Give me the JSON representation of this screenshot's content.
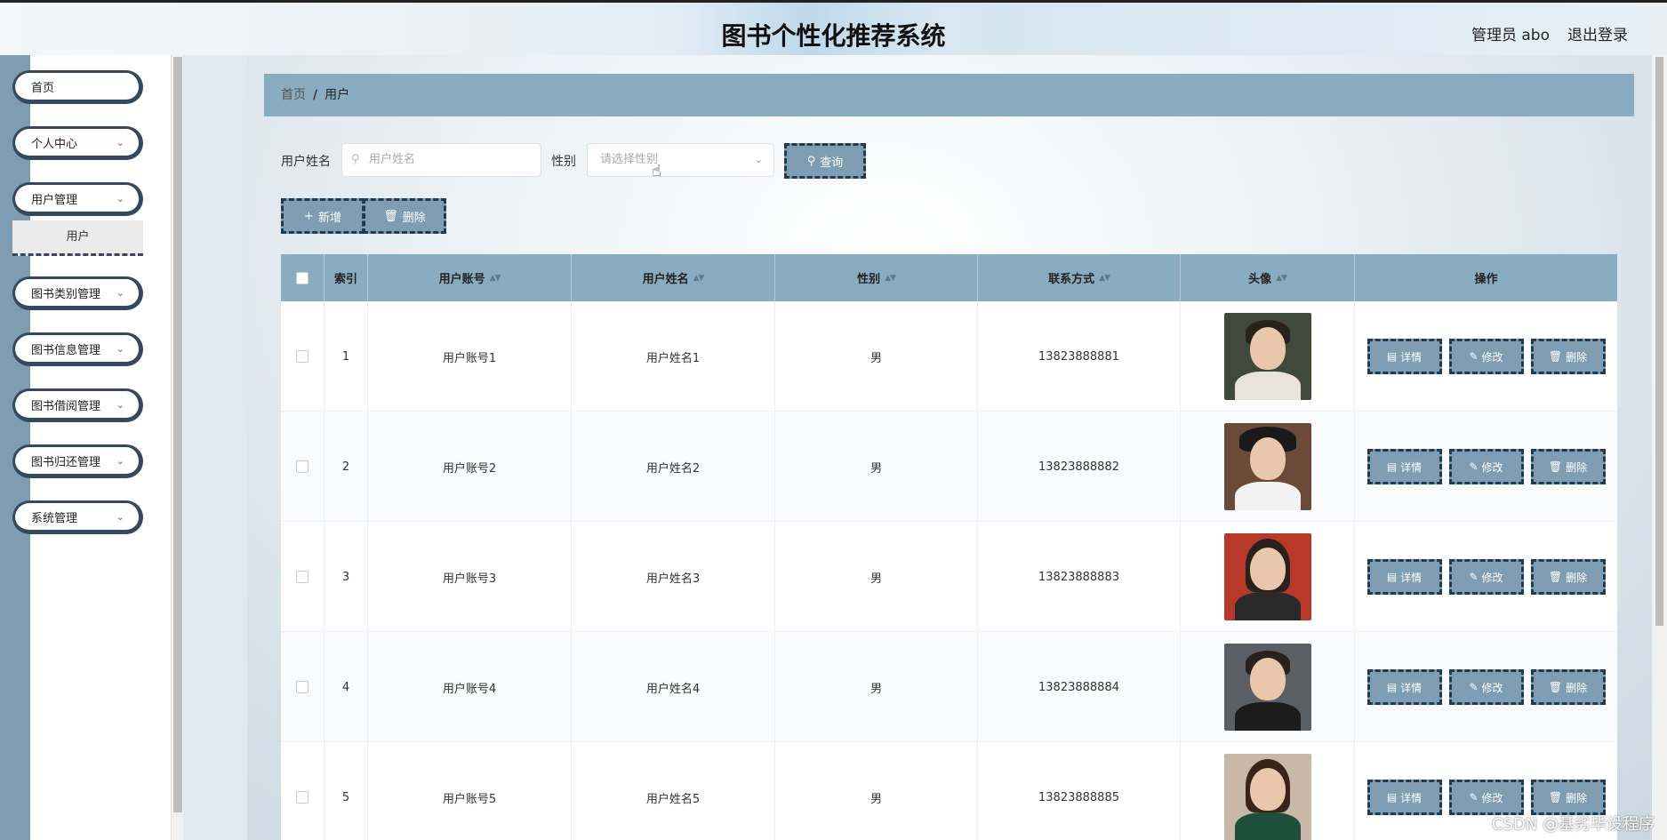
{
  "header": {
    "title": "图书个性化推荐系统",
    "user_label": "管理员 abo",
    "logout_label": "退出登录"
  },
  "sidebar": {
    "items": [
      {
        "label": "首页"
      },
      {
        "label": "个人中心"
      },
      {
        "label": "用户管理"
      },
      {
        "label": "图书类别管理"
      },
      {
        "label": "图书信息管理"
      },
      {
        "label": "图书借阅管理"
      },
      {
        "label": "图书归还管理"
      },
      {
        "label": "系统管理"
      }
    ],
    "submenu_active": "用户"
  },
  "breadcrumb": {
    "home": "首页",
    "separator": "/",
    "current": "用户"
  },
  "search": {
    "name_label": "用户姓名",
    "name_placeholder": "用户姓名",
    "gender_label": "性别",
    "gender_placeholder": "请选择性别",
    "query_label": "查询"
  },
  "actions": {
    "add_label": "新增",
    "delete_label": "删除"
  },
  "table": {
    "columns": [
      "索引",
      "用户账号",
      "用户姓名",
      "性别",
      "联系方式",
      "头像",
      "操作"
    ],
    "rows": [
      {
        "index": "1",
        "account": "用户账号1",
        "name": "用户姓名1",
        "gender": "男",
        "phone": "13823888881"
      },
      {
        "index": "2",
        "account": "用户账号2",
        "name": "用户姓名2",
        "gender": "男",
        "phone": "13823888882"
      },
      {
        "index": "3",
        "account": "用户账号3",
        "name": "用户姓名3",
        "gender": "男",
        "phone": "13823888883"
      },
      {
        "index": "4",
        "account": "用户账号4",
        "name": "用户姓名4",
        "gender": "男",
        "phone": "13823888884"
      },
      {
        "index": "5",
        "account": "用户账号5",
        "name": "用户姓名5",
        "gender": "男",
        "phone": "13823888885"
      }
    ],
    "op_labels": {
      "detail": "详情",
      "edit": "修改",
      "delete": "删除"
    }
  },
  "watermark": "CSDN @基劣毕设程序",
  "colors": {
    "accent": "#7f9db2",
    "header_row": "#8aacc0",
    "dash_border": "#1f3b52"
  }
}
